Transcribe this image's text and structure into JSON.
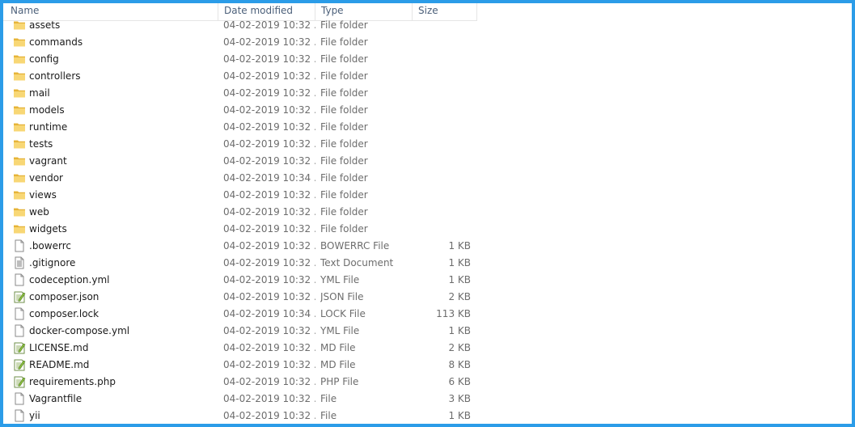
{
  "columns": {
    "name": "Name",
    "date": "Date modified",
    "type": "Type",
    "size": "Size"
  },
  "files": [
    {
      "name": "assets",
      "date": "04-02-2019 10:32 ...",
      "type": "File folder",
      "size": "",
      "icon": "folder-icon"
    },
    {
      "name": "commands",
      "date": "04-02-2019 10:32 ...",
      "type": "File folder",
      "size": "",
      "icon": "folder-icon"
    },
    {
      "name": "config",
      "date": "04-02-2019 10:32 ...",
      "type": "File folder",
      "size": "",
      "icon": "folder-icon"
    },
    {
      "name": "controllers",
      "date": "04-02-2019 10:32 ...",
      "type": "File folder",
      "size": "",
      "icon": "folder-icon"
    },
    {
      "name": "mail",
      "date": "04-02-2019 10:32 ...",
      "type": "File folder",
      "size": "",
      "icon": "folder-icon"
    },
    {
      "name": "models",
      "date": "04-02-2019 10:32 ...",
      "type": "File folder",
      "size": "",
      "icon": "folder-icon"
    },
    {
      "name": "runtime",
      "date": "04-02-2019 10:32 ...",
      "type": "File folder",
      "size": "",
      "icon": "folder-icon"
    },
    {
      "name": "tests",
      "date": "04-02-2019 10:32 ...",
      "type": "File folder",
      "size": "",
      "icon": "folder-icon"
    },
    {
      "name": "vagrant",
      "date": "04-02-2019 10:32 ...",
      "type": "File folder",
      "size": "",
      "icon": "folder-icon"
    },
    {
      "name": "vendor",
      "date": "04-02-2019 10:34 ...",
      "type": "File folder",
      "size": "",
      "icon": "folder-icon"
    },
    {
      "name": "views",
      "date": "04-02-2019 10:32 ...",
      "type": "File folder",
      "size": "",
      "icon": "folder-icon"
    },
    {
      "name": "web",
      "date": "04-02-2019 10:32 ...",
      "type": "File folder",
      "size": "",
      "icon": "folder-icon"
    },
    {
      "name": "widgets",
      "date": "04-02-2019 10:32 ...",
      "type": "File folder",
      "size": "",
      "icon": "folder-icon"
    },
    {
      "name": ".bowerrc",
      "date": "04-02-2019 10:32 ...",
      "type": "BOWERRC File",
      "size": "1 KB",
      "icon": "blank-file-icon"
    },
    {
      "name": ".gitignore",
      "date": "04-02-2019 10:32 ...",
      "type": "Text Document",
      "size": "1 KB",
      "icon": "text-document-icon"
    },
    {
      "name": "codeception.yml",
      "date": "04-02-2019 10:32 ...",
      "type": "YML File",
      "size": "1 KB",
      "icon": "blank-file-icon"
    },
    {
      "name": "composer.json",
      "date": "04-02-2019 10:32 ...",
      "type": "JSON File",
      "size": "2 KB",
      "icon": "notepadpp-file-icon"
    },
    {
      "name": "composer.lock",
      "date": "04-02-2019 10:34 ...",
      "type": "LOCK File",
      "size": "113 KB",
      "icon": "blank-file-icon"
    },
    {
      "name": "docker-compose.yml",
      "date": "04-02-2019 10:32 ...",
      "type": "YML File",
      "size": "1 KB",
      "icon": "blank-file-icon"
    },
    {
      "name": "LICENSE.md",
      "date": "04-02-2019 10:32 ...",
      "type": "MD File",
      "size": "2 KB",
      "icon": "notepadpp-file-icon"
    },
    {
      "name": "README.md",
      "date": "04-02-2019 10:32 ...",
      "type": "MD File",
      "size": "8 KB",
      "icon": "notepadpp-file-icon"
    },
    {
      "name": "requirements.php",
      "date": "04-02-2019 10:32 ...",
      "type": "PHP File",
      "size": "6 KB",
      "icon": "notepadpp-file-icon"
    },
    {
      "name": "Vagrantfile",
      "date": "04-02-2019 10:32 ...",
      "type": "File",
      "size": "3 KB",
      "icon": "blank-file-icon"
    },
    {
      "name": "yii",
      "date": "04-02-2019 10:32 ...",
      "type": "File",
      "size": "1 KB",
      "icon": "blank-file-icon"
    }
  ],
  "colors": {
    "window_border": "#2b9ce8",
    "folder_yellow": "#f5c542",
    "header_text": "#4c607a"
  }
}
